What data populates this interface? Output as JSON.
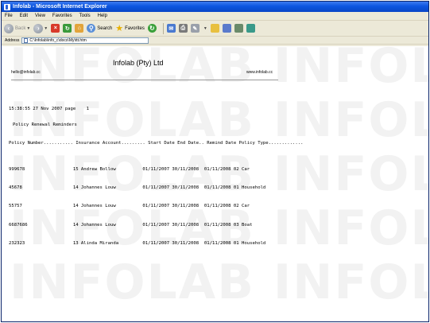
{
  "window": {
    "title": "Infolab - Microsoft Internet Explorer"
  },
  "menu": [
    "File",
    "Edit",
    "View",
    "Favorites",
    "Tools",
    "Help"
  ],
  "toolbar": {
    "back_label": "Back",
    "search_label": "Search",
    "favorites_label": "Favorites"
  },
  "address": {
    "label": "Address",
    "value": "C:\\Infolab\\info_c\\docs\\My\\ttt.htm"
  },
  "report": {
    "company": "Infolab (Pty) Ltd",
    "email": "hello@infolab.cc",
    "website": "www.infolab.cc",
    "stamp": "15:38:55 27 Nov 2007 page    1",
    "subtitle": "Policy Renewal Reminders",
    "column_header": "Policy Number........... Insurance Account......... Start Date End Date.. Remind Date Policy Type.............",
    "rows": [
      "999678                  15 Andrew Bollow          01/11/2007 30/11/2008  01/11/2008 02 Car",
      "45678                   14 Johannes Louw          01/11/2007 30/11/2008  01/11/2008 01 Household",
      "55757                   14 Johannes Louw          01/11/2007 30/11/2008  01/11/2008 02 Car",
      "6687686                 14 Johannes Louw          01/11/2007 30/11/2008  01/11/2008 03 Boat",
      "232323                  13 Alinda Miranda         01/11/2007 30/11/2008  01/11/2008 01 Household"
    ],
    "watermark": "INFOLAB INFOLAB"
  },
  "colors": {
    "titlebar": "#0c56e0",
    "chrome": "#ece9d8",
    "watermark": "#f2f2f2"
  }
}
